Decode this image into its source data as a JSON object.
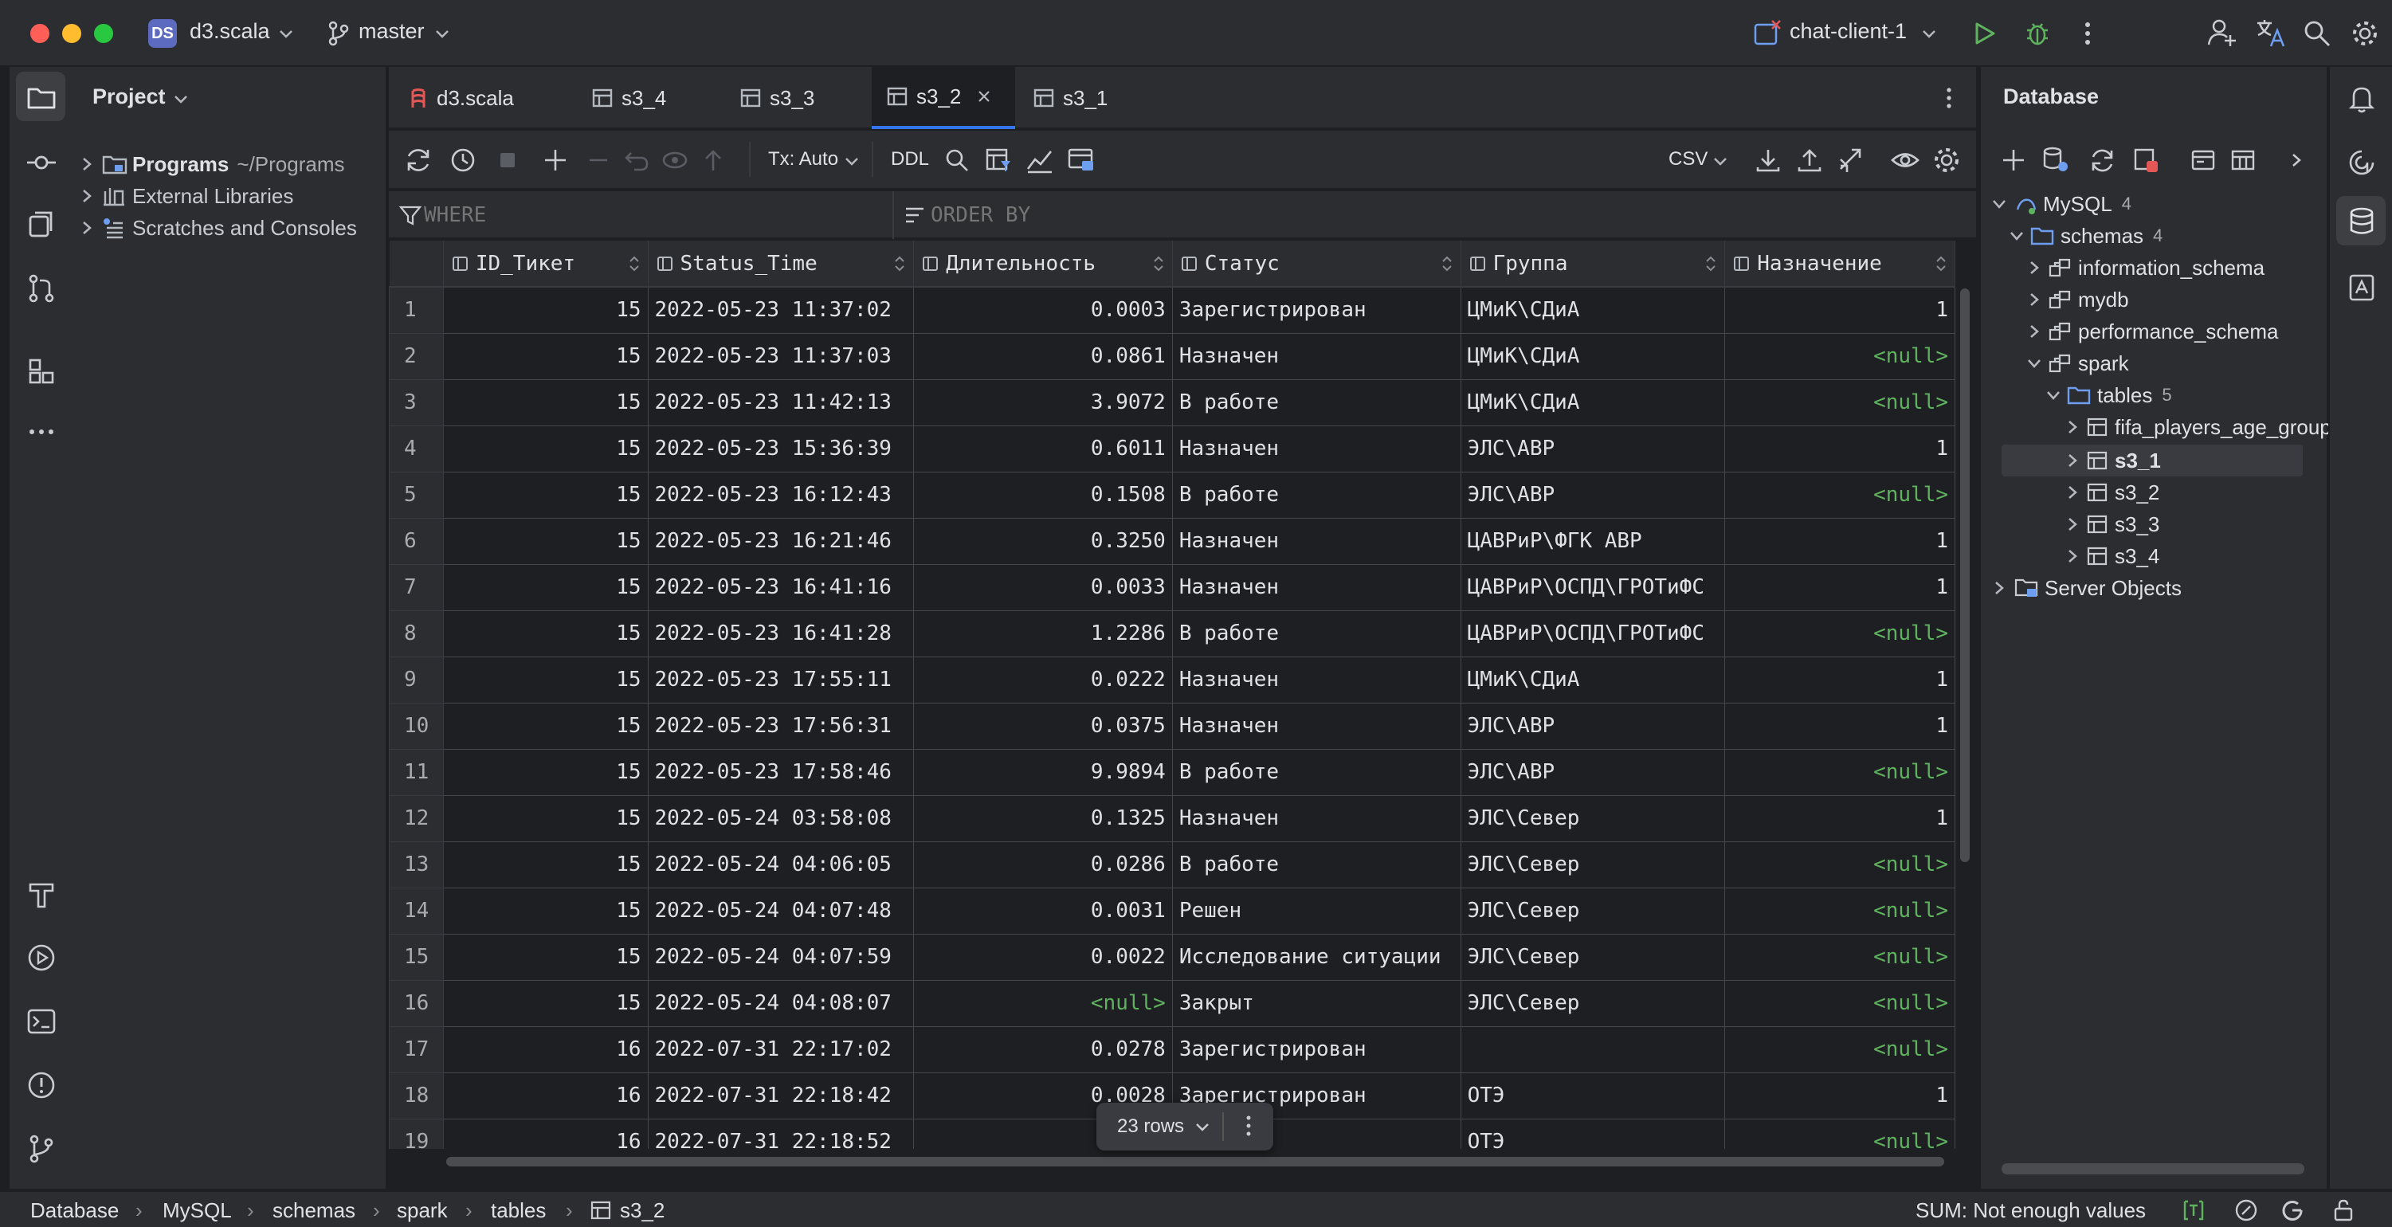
{
  "titlebar": {
    "project_badge": "DS",
    "project_name": "d3.scala",
    "branch": "master",
    "run_config": "chat-client-1"
  },
  "project_panel": {
    "title": "Project",
    "items": [
      {
        "label": "Programs",
        "path": "~/Programs"
      },
      {
        "label": "External Libraries"
      },
      {
        "label": "Scratches and Consoles"
      }
    ]
  },
  "tabs": [
    {
      "label": "d3.scala"
    },
    {
      "label": "s3_4"
    },
    {
      "label": "s3_3"
    },
    {
      "label": "s3_2"
    },
    {
      "label": "s3_1"
    }
  ],
  "toolbar": {
    "tx": "Tx: Auto",
    "ddl": "DDL",
    "format": "CSV"
  },
  "filter": {
    "where": "WHERE",
    "order_by": "ORDER BY"
  },
  "grid": {
    "columns": [
      "ID_Тикет",
      "Status_Time",
      "Длительность",
      "Статус",
      "Группа",
      "Назначение"
    ],
    "rows": [
      [
        "1",
        "15",
        "2022-05-23 11:37:02",
        "0.0003",
        "Зарегистрирован",
        "ЦМиК\\СДиА",
        "1"
      ],
      [
        "2",
        "15",
        "2022-05-23 11:37:03",
        "0.0861",
        "Назначен",
        "ЦМиК\\СДиА",
        "<null>"
      ],
      [
        "3",
        "15",
        "2022-05-23 11:42:13",
        "3.9072",
        "В работе",
        "ЦМиК\\СДиА",
        "<null>"
      ],
      [
        "4",
        "15",
        "2022-05-23 15:36:39",
        "0.6011",
        "Назначен",
        "ЭЛС\\АВР",
        "1"
      ],
      [
        "5",
        "15",
        "2022-05-23 16:12:43",
        "0.1508",
        "В работе",
        "ЭЛС\\АВР",
        "<null>"
      ],
      [
        "6",
        "15",
        "2022-05-23 16:21:46",
        "0.3250",
        "Назначен",
        "ЦАВРиР\\ФГК АВР",
        "1"
      ],
      [
        "7",
        "15",
        "2022-05-23 16:41:16",
        "0.0033",
        "Назначен",
        "ЦАВРиР\\ОСПД\\ГРОТиФС",
        "1"
      ],
      [
        "8",
        "15",
        "2022-05-23 16:41:28",
        "1.2286",
        "В работе",
        "ЦАВРиР\\ОСПД\\ГРОТиФС",
        "<null>"
      ],
      [
        "9",
        "15",
        "2022-05-23 17:55:11",
        "0.0222",
        "Назначен",
        "ЦМиК\\СДиА",
        "1"
      ],
      [
        "10",
        "15",
        "2022-05-23 17:56:31",
        "0.0375",
        "Назначен",
        "ЭЛС\\АВР",
        "1"
      ],
      [
        "11",
        "15",
        "2022-05-23 17:58:46",
        "9.9894",
        "В работе",
        "ЭЛС\\АВР",
        "<null>"
      ],
      [
        "12",
        "15",
        "2022-05-24 03:58:08",
        "0.1325",
        "Назначен",
        "ЭЛС\\Север",
        "1"
      ],
      [
        "13",
        "15",
        "2022-05-24 04:06:05",
        "0.0286",
        "В работе",
        "ЭЛС\\Север",
        "<null>"
      ],
      [
        "14",
        "15",
        "2022-05-24 04:07:48",
        "0.0031",
        "Решен",
        "ЭЛС\\Север",
        "<null>"
      ],
      [
        "15",
        "15",
        "2022-05-24 04:07:59",
        "0.0022",
        "Исследование ситуации",
        "ЭЛС\\Север",
        "<null>"
      ],
      [
        "16",
        "15",
        "2022-05-24 04:08:07",
        "<null>",
        "Закрыт",
        "ЭЛС\\Север",
        "<null>"
      ],
      [
        "17",
        "16",
        "2022-07-31 22:17:02",
        "0.0278",
        "Зарегистрирован",
        "",
        "<null>"
      ],
      [
        "18",
        "16",
        "2022-07-31 22:18:42",
        "0.0028",
        "Зарегистрирован",
        "ОТЭ",
        "1"
      ],
      [
        "19",
        "16",
        "2022-07-31 22:18:52",
        "0.",
        "н",
        "ОТЭ",
        "<null>"
      ]
    ],
    "rows_popup": "23 rows"
  },
  "database_panel": {
    "title": "Database",
    "tree": [
      {
        "label": "MySQL",
        "count": "4"
      },
      {
        "label": "schemas",
        "count": "4"
      },
      {
        "label": "information_schema"
      },
      {
        "label": "mydb"
      },
      {
        "label": "performance_schema"
      },
      {
        "label": "spark"
      },
      {
        "label": "tables",
        "count": "5"
      },
      {
        "label": "fifa_players_age_groups"
      },
      {
        "label": "s3_1"
      },
      {
        "label": "s3_2"
      },
      {
        "label": "s3_3"
      },
      {
        "label": "s3_4"
      },
      {
        "label": "Server Objects"
      }
    ]
  },
  "statusbar": {
    "breadcrumbs": [
      "Database",
      "MySQL",
      "schemas",
      "spark",
      "tables",
      "s3_2"
    ],
    "sum": "SUM: Not enough values"
  },
  "colors": {
    "accent": "#3574f0",
    "null": "#5fb35f",
    "run": "#5fb35f",
    "bg": "#1e1f22",
    "panel": "#2b2d30"
  }
}
